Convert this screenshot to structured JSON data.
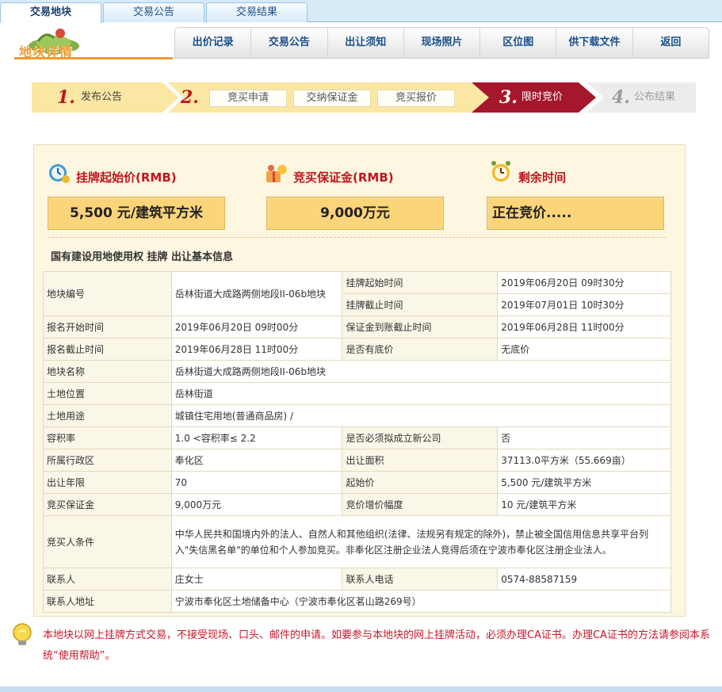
{
  "top_tabs": [
    "交易地块",
    "交易公告",
    "交易结果"
  ],
  "logo_text": "地块详情",
  "nav": [
    "出价记录",
    "交易公告",
    "出让须知",
    "现场照片",
    "区位图",
    "供下载文件",
    "返回"
  ],
  "steps": {
    "s1_num": "1.",
    "s1_label": "发布公告",
    "s2_num": "2.",
    "s2_subs": [
      "竞买申请",
      "交纳保证金",
      "竞买报价"
    ],
    "s3_num": "3.",
    "s3_label": "限时竞价",
    "s4_num": "4.",
    "s4_label": "公布结果"
  },
  "prices": {
    "start_title": "挂牌起始价(RMB)",
    "start_value": "5,500 元/建筑平方米",
    "deposit_title": "竞买保证金(RMB)",
    "deposit_value": "9,000万元",
    "time_title": "剩余时间",
    "time_value": "正在竞价....."
  },
  "section_title": "国有建设用地使用权 挂牌 出让基本信息",
  "info": {
    "plot_no_label": "地块编号",
    "plot_no": "岳林街道大成路两侧地段II-06b地块",
    "list_start_label": "挂牌起始时间",
    "list_start": "2019年06月20日 09时30分",
    "list_end_label": "挂牌截止时间",
    "list_end": "2019年07月01日 10时30分",
    "reg_start_label": "报名开始时间",
    "reg_start": "2019年06月20日 09时00分",
    "deposit_deadline_label": "保证金到账截止时间",
    "deposit_deadline": "2019年06月28日 11时00分",
    "reg_end_label": "报名截止时间",
    "reg_end": "2019年06月28日 11时00分",
    "reserve_label": "是否有底价",
    "reserve": "无底价",
    "name_label": "地块名称",
    "name": "岳林街道大成路两侧地段II-06b地块",
    "location_label": "土地位置",
    "location": "岳林街道",
    "use_label": "土地用途",
    "use": "城镇住宅用地(普通商品房) /",
    "far_label": "容积率",
    "far": "1.0 <容积率≤ 2.2",
    "new_company_label": "是否必须拟成立新公司",
    "new_company": "否",
    "district_label": "所属行政区",
    "district": "奉化区",
    "area_label": "出让面积",
    "area": "37113.0平方米（55.669亩）",
    "term_label": "出让年限",
    "term": "70",
    "start_price_label": "起始价",
    "start_price": "5,500 元/建筑平方米",
    "bid_deposit_label": "竞买保证金",
    "bid_deposit": "9,000万元",
    "increment_label": "竞价增价幅度",
    "increment": "10 元/建筑平方米",
    "conditions_label": "竞买人条件",
    "conditions": "中华人民共和国境内外的法人、自然人和其他组织(法律、法规另有规定的除外)，禁止被全国信用信息共享平台列入\"失信黑名单\"的单位和个人参加竞买。非奉化区注册企业法人竞得后须在宁波市奉化区注册企业法人。",
    "contact_label": "联系人",
    "contact": "庄女士",
    "phone_label": "联系人电话",
    "phone": "0574-88587159",
    "address_label": "联系人地址",
    "address": "宁波市奉化区土地储备中心（宁波市奉化区茗山路269号）"
  },
  "note": "本地块以网上挂牌方式交易，不接受现场、口头、邮件的申请。如要参与本地块的网上挂牌活动，必须办理CA证书。办理CA证书的方法请参阅本系统“使用帮助”。",
  "colors": {
    "accent_red": "#c1161f",
    "step_active": "#a5172a",
    "price_box": "#fcd47a",
    "tab_blue": "#1a4f8b"
  },
  "icons": [
    "clock-coin-icon",
    "gift-coin-icon",
    "alarm-clock-icon",
    "lightbulb-icon"
  ]
}
